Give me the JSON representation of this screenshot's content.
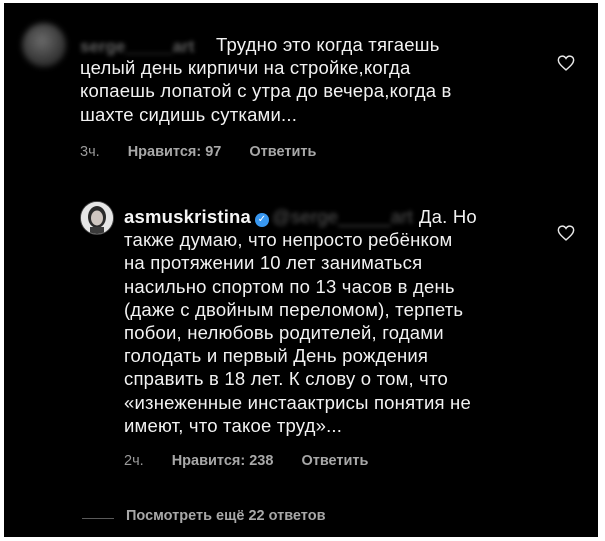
{
  "comment1": {
    "username": "serge_____art",
    "lines": [
      "Трудно это когда тягаешь",
      "целый день кирпичи на стройке,когда",
      "копаешь лопатой с утра до вечера,когда в",
      "шахте сидишь сутками..."
    ],
    "time": "3ч.",
    "likes": "Нравится: 97",
    "reply": "Ответить"
  },
  "comment2": {
    "username": "asmuskristina",
    "mention": "@serge_____art",
    "first_line_tail": "Да. Но",
    "lines": [
      "также думаю, что непросто ребёнком",
      "на протяжении 10 лет заниматься",
      "насильно спортом по 13 часов в день",
      "(даже с двойным переломом), терпеть",
      "побои, нелюбовь родителей, годами",
      "голодать и первый День рождения",
      "справить в 18 лет. К слову о том, что",
      "«изнеженные инстаактрисы понятия не",
      "имеют, что такое труд»..."
    ],
    "time": "2ч.",
    "likes": "Нравится: 238",
    "reply": "Ответить"
  },
  "view_replies": "Посмотреть ещё 22 ответов",
  "icons": {
    "like": "heart-outline-icon",
    "verified": "verified-badge-icon"
  },
  "colors": {
    "background": "#000000",
    "text": "#f2f2f2",
    "meta": "#9a9a9a",
    "verified": "#3897f0"
  }
}
